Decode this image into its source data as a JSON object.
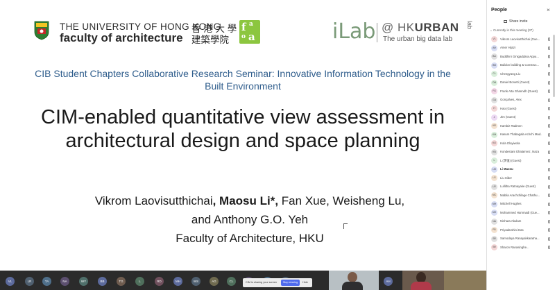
{
  "slide": {
    "hku_line1": "THE UNIVERSITY OF HONG KONG",
    "hku_line2": "faculty of architecture",
    "hku_cn1": "香 港 大 學",
    "hku_cn2": "建築學院",
    "ilab": "iLab",
    "hkurban_at": "@ HK",
    "hkurban_bold": "URBAN",
    "hkurban_lab": "lab",
    "hkurban_sub": "The urban big data lab",
    "seminar": "CIB Student Chapters Collaborative Research Seminar: Innovative Information Technology in the Built Environment",
    "title": "CIM-enabled quantitative view assessment in architectural design and space planning",
    "authors_a": "Vikrom Laovisutthichai",
    "authors_b": ", Maosu Li*,",
    "authors_c": " Fan Xue, Weisheng Lu,",
    "authors_line2": "and Anthony G.O. Yeh",
    "affiliation": "Faculty of Architecture, HKU"
  },
  "people_panel": {
    "title": "People",
    "close": "×",
    "share_invite": "Share invite",
    "meeting_header": "Currently in this meeting (37)",
    "participants": [
      {
        "initials": "VL",
        "name": "Vikrom Laovisutthichai (Gue...",
        "color": "#f3d6d6"
      },
      {
        "initials": "AH",
        "name": "Amer Hijazi",
        "color": "#d6dcf3"
      },
      {
        "initials": "BA",
        "name": "Buddhini Ginigaddara Appu...",
        "color": "#e0e0e0"
      },
      {
        "initials": "BB",
        "name": "Bulidov building & Construc...",
        "color": "#d6dcf3"
      },
      {
        "initials": "CL",
        "name": "Chengyang Liu",
        "color": "#d9eedb"
      },
      {
        "initials": "DB",
        "name": "Daniel Bonetti (Guest)",
        "color": "#d9eedb"
      },
      {
        "initials": "FG",
        "name": "Frank Atta Ghanndh (Guest)",
        "color": "#f3d6e6"
      },
      {
        "initials": "GA",
        "name": "Gonçalves, Alex",
        "color": "#e0e0e0"
      },
      {
        "initials": "H",
        "name": "Hao (Guest)",
        "color": "#f3d6d6"
      },
      {
        "initials": "J",
        "name": "Jim (Guest)",
        "color": "#ecd9f3"
      },
      {
        "initials": "KR",
        "name": "Kambiz Radmen",
        "color": "#f3e2d0"
      },
      {
        "initials": "KM",
        "name": "Kasum Thabagala Achchi Mad...",
        "color": "#d9eedb"
      },
      {
        "initials": "KO",
        "name": "Kola Olayiwola",
        "color": "#f3d6d6"
      },
      {
        "initials": "KN",
        "name": "Kondestani Ghalamrez, Naza",
        "color": "#e0e0e0"
      },
      {
        "initials": "L",
        "name": "L (李强) (Guest)",
        "color": "#d9eedb"
      },
      {
        "initials": "LM",
        "name": "Li Maosu",
        "color": "#d6dcf3",
        "bold": true
      },
      {
        "initials": "LS",
        "name": "Liu Siber",
        "color": "#f3e2d0"
      },
      {
        "initials": "LR",
        "name": "Lullitha Ratnayake (Guest)",
        "color": "#e0e0e0"
      },
      {
        "initials": "MC",
        "name": "Mabila Arachchilage Chathu...",
        "color": "#f3e2d0"
      },
      {
        "initials": "MH",
        "name": "Mitchell Hughes",
        "color": "#d6dcf3"
      },
      {
        "initials": "MH",
        "name": "Mohammed Hammadi (Gue...",
        "color": "#d6dcf3"
      },
      {
        "initials": "NA",
        "name": "Nishara Abulam",
        "color": "#e0e0e0"
      },
      {
        "initials": "PD",
        "name": "Priyadarshini Das",
        "color": "#f3e2d0"
      },
      {
        "initials": "SR",
        "name": "Samodaya Ranayakkaratna...",
        "color": "#e0e0e0"
      },
      {
        "initials": "SR",
        "name": "Sharon Ranasinghe...",
        "color": "#f3d6d6"
      }
    ]
  },
  "bottom_bar": {
    "avatars": [
      {
        "initials": "VL",
        "color": "#5c6a9c"
      },
      {
        "initials": "LR",
        "color": "#4f5f6f"
      },
      {
        "initials": "TA",
        "color": "#4f6f8a"
      },
      {
        "initials": "NA",
        "color": "#5c4f6f"
      },
      {
        "initials": "WY",
        "color": "#4f6f6a"
      },
      {
        "initials": "BB",
        "color": "#5c6a9c"
      },
      {
        "initials": "TG",
        "color": "#6f5c4f"
      },
      {
        "initials": "L",
        "color": "#4f6f5c"
      },
      {
        "initials": "RD",
        "color": "#6f4f5c"
      },
      {
        "initials": "MH",
        "color": "#5c6a9c"
      },
      {
        "initials": "WS",
        "color": "#4f5f6f"
      },
      {
        "initials": "AG",
        "color": "#6f6a4f"
      },
      {
        "initials": "CL",
        "color": "#4f6f5c"
      },
      {
        "initials": "GW",
        "color": "#5c4f6f"
      },
      {
        "initials": "VP",
        "color": "#4f6f8a"
      },
      {
        "initials": "TW",
        "color": "#4f5f6f"
      },
      {
        "initials": "AH",
        "color": "#5c6a9c"
      }
    ],
    "share_banner_text": "CIM is sharing your screen",
    "share_banner_button": "Stop sharing",
    "share_banner_hide": "Hide"
  }
}
